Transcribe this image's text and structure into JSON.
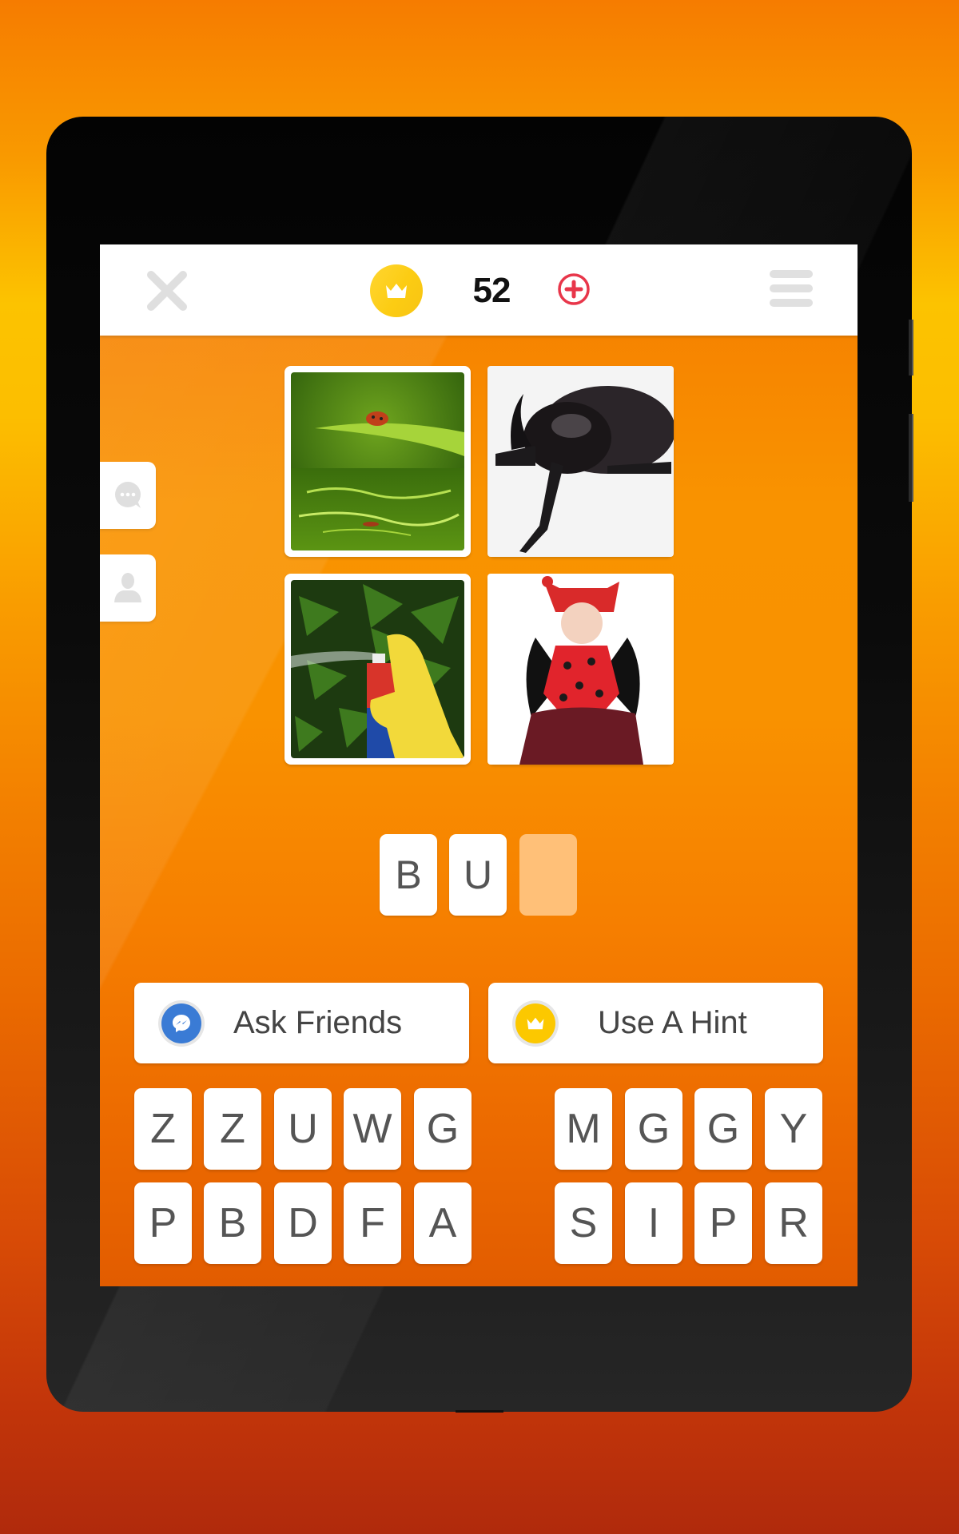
{
  "header": {
    "close_icon": "close-x-icon",
    "coin_icon": "crown-coin-icon",
    "coins": "52",
    "add_coins_icon": "plus-circle-icon",
    "menu_icon": "hamburger-menu-icon"
  },
  "side_tabs": [
    {
      "name": "chat",
      "icon": "chat-bubble-icon"
    },
    {
      "name": "profile",
      "icon": "user-profile-icon"
    }
  ],
  "puzzle_images": [
    {
      "description": "Ladybug on a leaf above water"
    },
    {
      "description": "Black rhinoceros beetle"
    },
    {
      "description": "Gloved hand spraying insecticide on leaves"
    },
    {
      "description": "Baby in ladybug costume"
    }
  ],
  "answer_slots": [
    "B",
    "U",
    ""
  ],
  "actions": {
    "ask_friends": {
      "label": "Ask Friends",
      "icon": "messenger-icon"
    },
    "use_hint": {
      "label": "Use A Hint",
      "icon": "crown-coin-icon"
    }
  },
  "letters": {
    "left": [
      [
        "Z",
        "Z",
        "U",
        "W",
        "G"
      ],
      [
        "P",
        "B",
        "D",
        "F",
        "A"
      ]
    ],
    "right": [
      [
        "M",
        "G",
        "G",
        "Y"
      ],
      [
        "S",
        "I",
        "P",
        "R"
      ]
    ]
  },
  "colors": {
    "coin": "#fcc800",
    "add": "#e8364a",
    "messenger": "#3a7bd5",
    "empty_slot": "#ffc078"
  }
}
